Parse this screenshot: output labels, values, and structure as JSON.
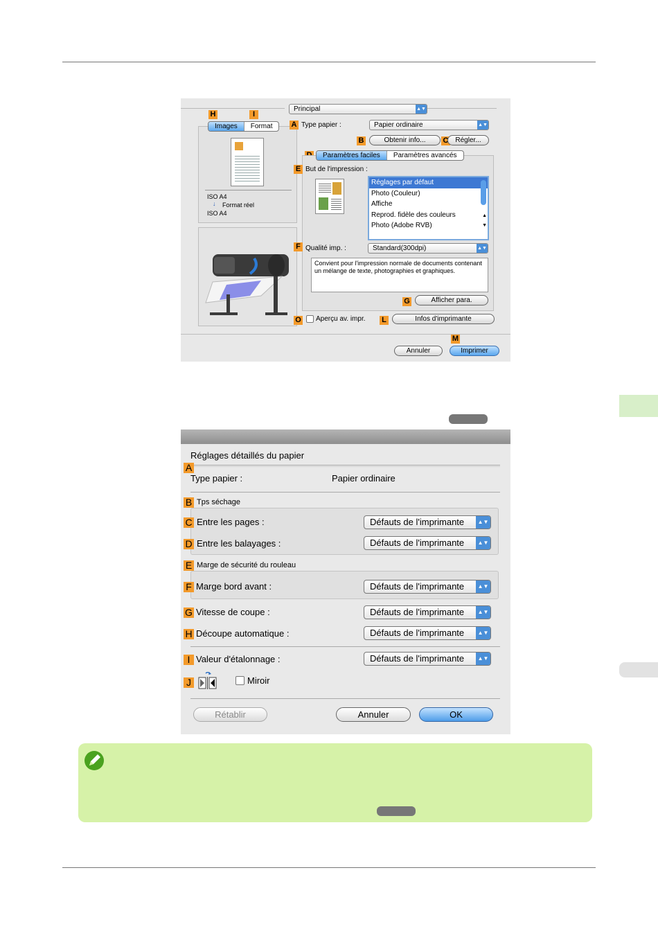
{
  "dialog1": {
    "principal_popup": "Principal",
    "tab_images": "Images",
    "tab_format": "Format",
    "type_papier_label": "Type papier :",
    "type_papier_value": "Papier ordinaire",
    "obtenir_info_button": "Obtenir info...",
    "regler_button": "Régler...",
    "tab_parametres_faciles": "Paramètres faciles",
    "tab_parametres_avances": "Paramètres avancés",
    "but_impression_label": "But de l'impression :",
    "but_impression_items": [
      "Réglages par défaut",
      "Photo (Couleur)",
      "Affiche",
      "Reprod. fidèle des couleurs",
      "Photo (Adobe RVB)"
    ],
    "paper_size_line1": "ISO A4",
    "paper_size_line2": "Format réel",
    "paper_size_line3": "ISO A4",
    "qualite_label": "Qualité imp. :",
    "qualite_value": "Standard(300dpi)",
    "description": "Convient pour l'impression normale de documents contenant un mélange de texte, photographies et graphiques.",
    "afficher_para_button": "Afficher para.",
    "apercu_label": "Aperçu av. impr.",
    "infos_imprimante_button": "Infos d'imprimante",
    "annuler_button": "Annuler",
    "imprimer_button": "Imprimer",
    "markers": {
      "H": "H",
      "I": "I",
      "A": "A",
      "B": "B",
      "C": "C",
      "D": "D",
      "E": "E",
      "F": "F",
      "G": "G",
      "O": "O",
      "L": "L",
      "M": "M"
    }
  },
  "dialog2": {
    "heading": "Réglages détaillés du papier",
    "type_papier_label": "Type papier :",
    "type_papier_value": "Papier ordinaire",
    "tps_sechage_label": "Tps séchage",
    "entre_pages_label": "Entre les pages :",
    "entre_balayages_label": "Entre les balayages :",
    "marge_securite_label": "Marge de sécurité du rouleau",
    "marge_bord_avant_label": "Marge bord avant :",
    "vitesse_coupe_label": "Vitesse de coupe :",
    "decoupe_auto_label": "Découpe automatique :",
    "valeur_etalonnage_label": "Valeur d'étalonnage :",
    "popup_value": "Défauts de l'imprimante",
    "miroir_label": "Miroir",
    "retablir_button": "Rétablir",
    "annuler_button": "Annuler",
    "ok_button": "OK",
    "markers": {
      "A": "A",
      "B": "B",
      "C": "C",
      "D": "D",
      "E": "E",
      "F": "F",
      "G": "G",
      "H": "H",
      "I": "I",
      "J": "J"
    }
  },
  "colors": {
    "marker": "#f39a2b",
    "note_bg": "#d6f2a8",
    "accent": "#4a8fd8"
  }
}
